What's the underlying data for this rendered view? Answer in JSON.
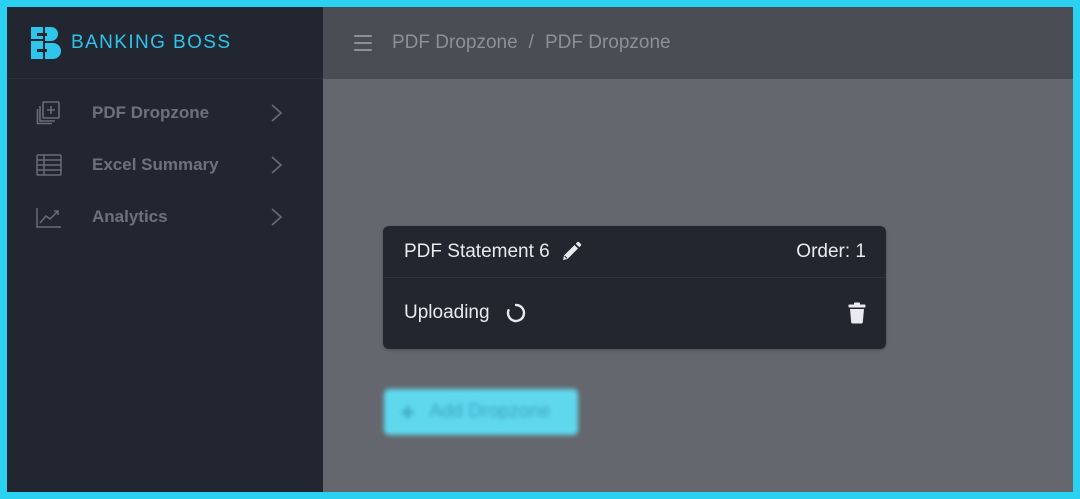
{
  "brand": {
    "name": "BANKING BOSS",
    "logo_icon": "banking-boss-logo",
    "accent_color": "#2fc4ea"
  },
  "sidebar": {
    "items": [
      {
        "label": "PDF Dropzone",
        "icon": "add-document-icon"
      },
      {
        "label": "Excel Summary",
        "icon": "spreadsheet-icon"
      },
      {
        "label": "Analytics",
        "icon": "line-chart-icon"
      }
    ]
  },
  "topbar": {
    "menu_icon": "hamburger-icon",
    "breadcrumb": [
      "PDF Dropzone",
      "PDF Dropzone"
    ],
    "separator": "/"
  },
  "dropzone_card": {
    "title": "PDF Statement 6",
    "order_label": "Order: 1",
    "status": "Uploading",
    "status_icon": "spinner-icon",
    "edit_icon": "pencil-icon",
    "delete_icon": "trash-icon"
  },
  "add_button": {
    "label": "Add Dropzone",
    "icon": "plus-icon",
    "color": "#5fd8ee"
  }
}
